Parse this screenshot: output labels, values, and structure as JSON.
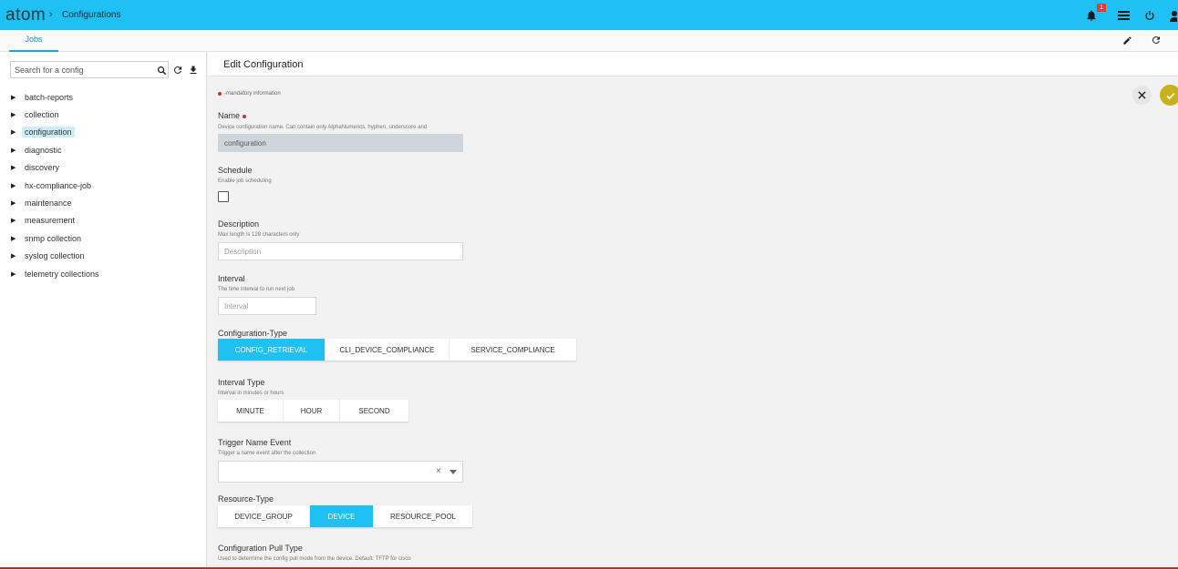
{
  "app": {
    "logo": "atom",
    "breadcrumb_sep": "›",
    "breadcrumb": "Configurations",
    "notification_count": "1"
  },
  "tabs": [
    {
      "label": "Jobs",
      "active": true
    }
  ],
  "sidebar": {
    "search_placeholder": "Search for a config",
    "items": [
      {
        "label": "batch-reports"
      },
      {
        "label": "collection"
      },
      {
        "label": "configuration",
        "selected": true
      },
      {
        "label": "diagnostic"
      },
      {
        "label": "discovery"
      },
      {
        "label": "hx-compliance-job"
      },
      {
        "label": "maintenance"
      },
      {
        "label": "measurement"
      },
      {
        "label": "snmp collection"
      },
      {
        "label": "syslog collection"
      },
      {
        "label": "telemetry collections"
      }
    ]
  },
  "main": {
    "title": "Edit Configuration",
    "mandatory_note": "-mandatory information",
    "fields": {
      "name": {
        "label": "Name",
        "help": "Device configuration name. Can contain only AlphaNumerics, hyphen, underscore and",
        "value": "configuration"
      },
      "schedule": {
        "label": "Schedule",
        "help": "Enable job scheduling",
        "checked": false
      },
      "description": {
        "label": "Description",
        "help": "Max length is 128 characters only",
        "placeholder": "Description"
      },
      "interval": {
        "label": "Interval",
        "help": "The time interval to run next job",
        "placeholder": "Interval"
      },
      "configuration_type": {
        "label": "Configuration-Type",
        "options": [
          "CONFIG_RETRIEVAL",
          "CLI_DEVICE_COMPLIANCE",
          "SERVICE_COMPLIANCE"
        ],
        "selected": "CONFIG_RETRIEVAL"
      },
      "interval_type": {
        "label": "Interval Type",
        "help": "Interval in minutes or hours",
        "options": [
          "MINUTE",
          "HOUR",
          "SECOND"
        ],
        "selected": ""
      },
      "trigger_event": {
        "label": "Trigger Name Event",
        "help": "Trigger a name event after the collection",
        "value": "",
        "clear_symbol": "×"
      },
      "resource_type": {
        "label": "Resource-Type",
        "options": [
          "DEVICE_GROUP",
          "DEVICE",
          "RESOURCE_POOL"
        ],
        "selected": "DEVICE"
      },
      "config_pull_type": {
        "label": "Configuration Pull Type",
        "help": "Used to determine the config pull mode from the device. Default: TFTP for cisco"
      }
    }
  },
  "colors": {
    "topbar": "#1fc0f3",
    "accent": "#1fc0f3",
    "save": "#c9b11c",
    "required": "#d32f2f"
  }
}
